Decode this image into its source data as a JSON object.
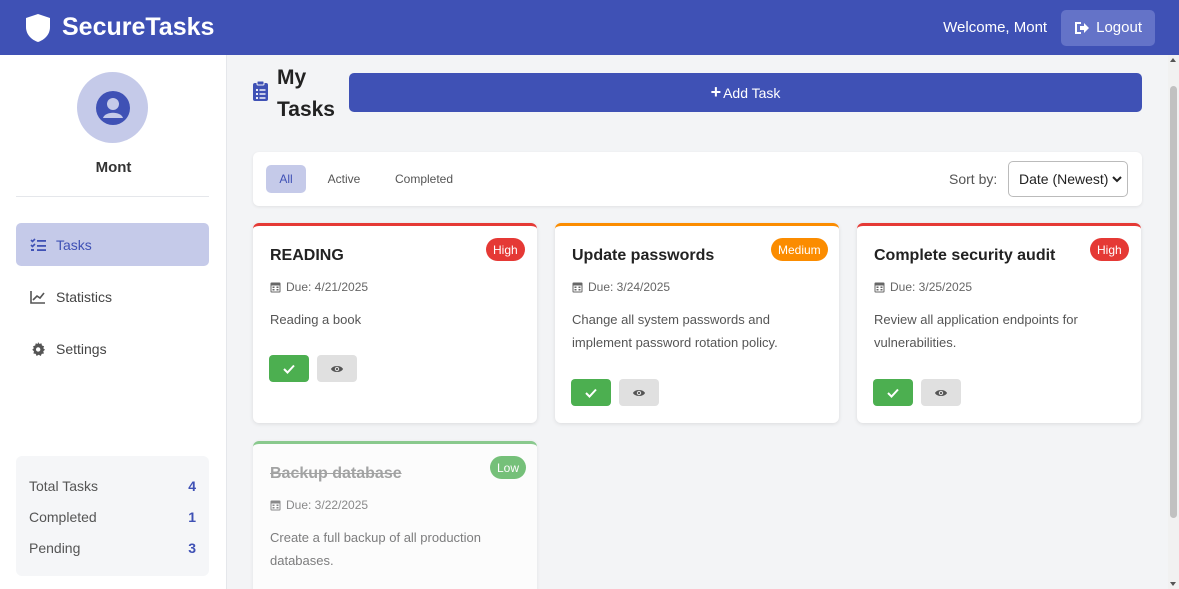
{
  "header": {
    "app_name": "SecureTasks",
    "welcome": "Welcome, Mont",
    "logout_label": "Logout",
    "bg_color": "#3f51b5"
  },
  "sidebar": {
    "username": "Mont",
    "nav": [
      {
        "label": "Tasks",
        "icon": "tasks-list-icon",
        "active": true
      },
      {
        "label": "Statistics",
        "icon": "line-chart-icon",
        "active": false
      },
      {
        "label": "Settings",
        "icon": "gear-icon",
        "active": false
      }
    ],
    "stats": [
      {
        "label": "Total Tasks",
        "value": "4"
      },
      {
        "label": "Completed",
        "value": "1"
      },
      {
        "label": "Pending",
        "value": "3"
      }
    ]
  },
  "main": {
    "title_line1": "My",
    "title_line2": "Tasks",
    "add_label": "Add Task",
    "filters": [
      {
        "label": "All",
        "active": true
      },
      {
        "label": "Active",
        "active": false
      },
      {
        "label": "Completed",
        "active": false
      }
    ],
    "sort_label": "Sort by:",
    "sort_value": "Date (Newest)"
  },
  "tasks": [
    {
      "title": "READING",
      "priority": "High",
      "due": "Due: 4/21/2025",
      "description": "Reading a book",
      "completed": false
    },
    {
      "title": "Update passwords",
      "priority": "Medium",
      "due": "Due: 3/24/2025",
      "description": "Change all system passwords and implement password rotation policy.",
      "completed": false
    },
    {
      "title": "Complete security audit",
      "priority": "High",
      "due": "Due: 3/25/2025",
      "description": "Review all application endpoints for vulnerabilities.",
      "completed": false
    },
    {
      "title": "Backup database",
      "priority": "Low",
      "due": "Due: 3/22/2025",
      "description": "Create a full backup of all production databases.",
      "completed": true
    }
  ],
  "colors": {
    "primary": "#3f51b5",
    "high": "#e53935",
    "medium": "#fb8c00",
    "low": "#4caf50"
  }
}
